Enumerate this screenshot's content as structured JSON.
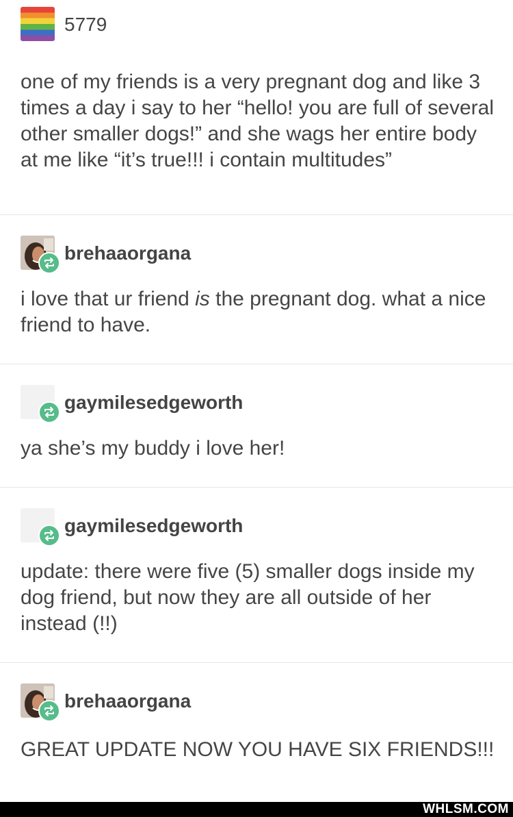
{
  "posts": [
    {
      "username": "5779",
      "avatar": "rainbow-flag",
      "reblog": false,
      "body": "one of my friends is a very pregnant dog and like 3 times a day i say to her “hello! you are full of several other smaller dogs!” and she wags her entire body at me like “it’s true!!! i contain multitudes”"
    },
    {
      "username": "brehaaorgana",
      "avatar": "photo",
      "reblog": true,
      "body_before": "i love that ur friend ",
      "body_em": "is",
      "body_after": " the pregnant dog. what a nice friend to have."
    },
    {
      "username": "gaymilesedgeworth",
      "avatar": "blank",
      "reblog": true,
      "body": "ya she’s my buddy i love her!"
    },
    {
      "username": "gaymilesedgeworth",
      "avatar": "blank",
      "reblog": true,
      "body": "update: there were five (5) smaller dogs inside my dog friend, but now they are all outside of her instead (!!)"
    },
    {
      "username": "brehaaorgana",
      "avatar": "photo",
      "reblog": true,
      "body": "GREAT UPDATE NOW YOU HAVE SIX FRIENDS!!!"
    }
  ],
  "watermark": "WHLSM.COM",
  "colors": {
    "reblog_badge": "#56bc8a",
    "text": "#454545",
    "divider": "#e6e6e6",
    "footer_bar": "#000000"
  },
  "icons": {
    "reblog": "reblog-icon"
  }
}
